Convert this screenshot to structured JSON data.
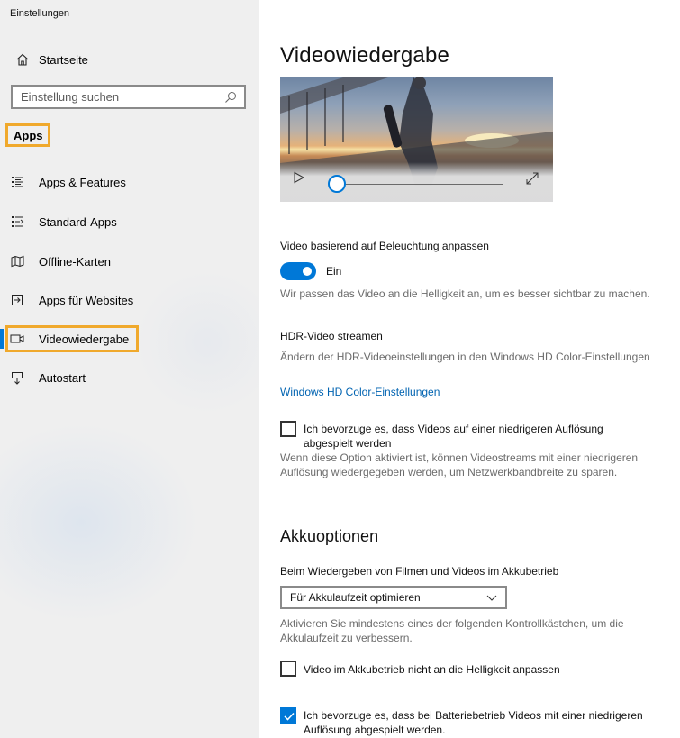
{
  "window": {
    "title": "Einstellungen"
  },
  "sidebar": {
    "home_label": "Startseite",
    "search_placeholder": "Einstellung suchen",
    "section_label": "Apps",
    "items": [
      {
        "label": "Apps & Features",
        "icon": "apps-features-icon"
      },
      {
        "label": "Standard-Apps",
        "icon": "default-apps-icon"
      },
      {
        "label": "Offline-Karten",
        "icon": "map-icon"
      },
      {
        "label": "Apps für Websites",
        "icon": "web-apps-icon"
      },
      {
        "label": "Videowiedergabe",
        "icon": "video-icon",
        "selected": true
      },
      {
        "label": "Autostart",
        "icon": "startup-icon"
      }
    ]
  },
  "main": {
    "title": "Videowiedergabe",
    "preview": {
      "progress": 0.0
    },
    "lighting": {
      "label": "Video basierend auf Beleuchtung anpassen",
      "toggle_label": "Ein",
      "toggle_on": true,
      "description": "Wir passen das Video an die Helligkeit an, um es besser sichtbar zu machen."
    },
    "hdr": {
      "heading": "HDR-Video streamen",
      "description": "Ändern der HDR-Videoeinstellungen in den Windows HD Color-Einstellungen",
      "link": "Windows HD Color-Einstellungen"
    },
    "low_res": {
      "label": "Ich bevorzuge es, dass Videos auf einer niedrigeren Auflösung abgespielt werden",
      "checked": false,
      "description": "Wenn diese Option aktiviert ist, können Videostreams mit einer niedrigeren Auflösung wiedergegeben werden, um Netzwerkbandbreite zu sparen."
    },
    "battery": {
      "heading": "Akkuoptionen",
      "select_label": "Beim Wiedergeben von Filmen und Videos im Akkubetrieb",
      "select_value": "Für Akkulaufzeit optimieren",
      "description": "Aktivieren Sie mindestens eines der folgenden Kontrollkästchen, um die Akkulaufzeit zu verbessern.",
      "options": [
        {
          "label": "Video im Akkubetrieb nicht an die Helligkeit anpassen",
          "checked": false
        },
        {
          "label": "Ich bevorzuge es, dass bei Batteriebetrieb Videos mit einer niedrigeren Auflösung abgespielt werden.",
          "checked": true
        }
      ]
    }
  },
  "colors": {
    "accent": "#0078d7",
    "highlight": "#f0a92c",
    "link": "#0063b1"
  }
}
